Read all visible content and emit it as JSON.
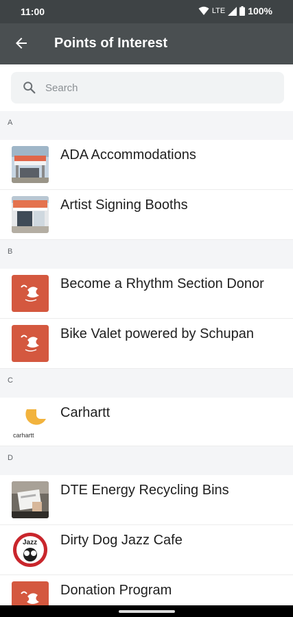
{
  "status": {
    "time": "11:00",
    "network": "LTE",
    "battery": "100%",
    "icons": [
      "wifi-icon",
      "cell-signal-icon",
      "battery-icon"
    ]
  },
  "app_bar": {
    "title": "Points of Interest",
    "back_icon": "arrow-back-icon"
  },
  "search": {
    "placeholder": "Search",
    "value": "",
    "icon": "search-icon"
  },
  "sections": [
    {
      "letter": "A",
      "items": [
        {
          "label": "ADA Accommodations",
          "thumb": "tent-photo"
        },
        {
          "label": "Artist Signing Booths",
          "thumb": "booth-photo"
        }
      ]
    },
    {
      "letter": "B",
      "items": [
        {
          "label": "Become a Rhythm Section Donor",
          "thumb": "jazz-logo"
        },
        {
          "label": "Bike Valet powered by Schupan",
          "thumb": "jazz-logo"
        }
      ]
    },
    {
      "letter": "C",
      "items": [
        {
          "label": "Carhartt",
          "thumb": "carhartt-logo",
          "logo_text": "carhartt"
        }
      ]
    },
    {
      "letter": "D",
      "items": [
        {
          "label": "DTE Energy Recycling Bins",
          "thumb": "recycling-photo"
        },
        {
          "label": "Dirty Dog Jazz Cafe",
          "thumb": "dirty-dog-logo",
          "logo_text": "Jazz"
        },
        {
          "label": "Donation Program",
          "thumb": "jazz-logo"
        }
      ]
    }
  ],
  "colors": {
    "status_bar": "#3e4345",
    "app_bar": "#4a4f51",
    "section_header_bg": "#f4f5f7",
    "jazz_orange": "#d4583f",
    "carhartt_yellow": "#f2b33d"
  }
}
